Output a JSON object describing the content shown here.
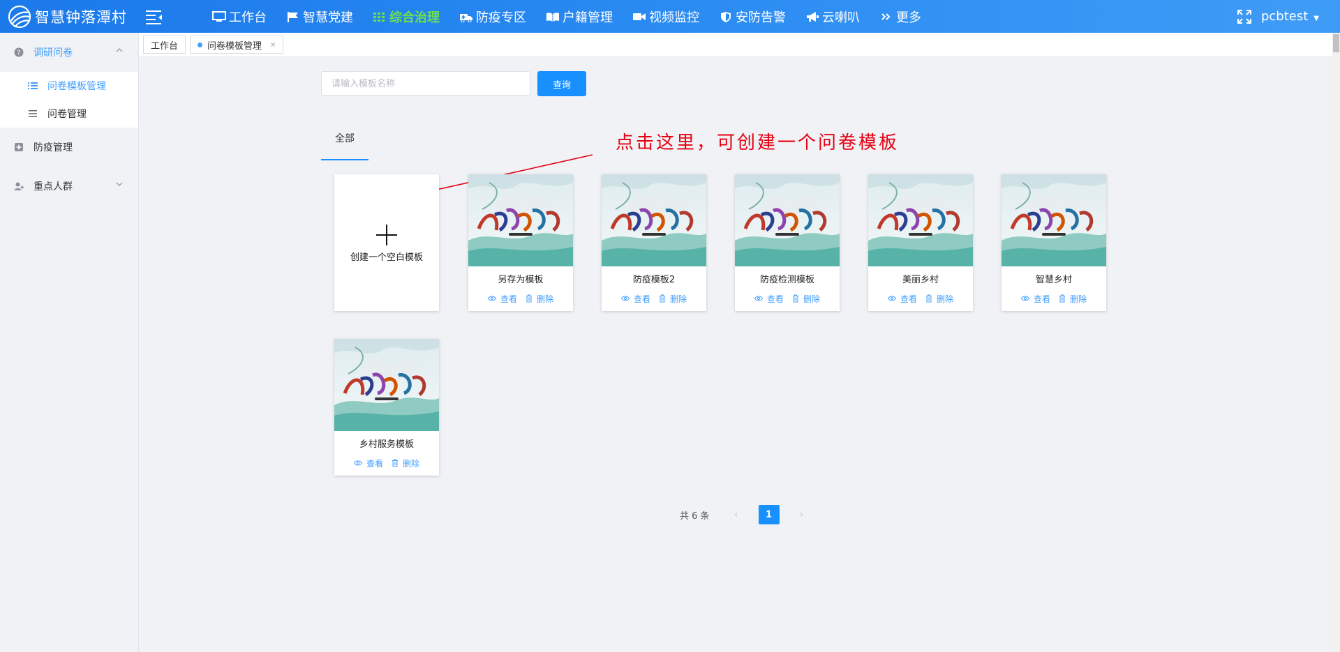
{
  "app": {
    "title": "智慧钟落潭村"
  },
  "nav": {
    "items": [
      {
        "label": "工作台",
        "icon": "monitor-icon"
      },
      {
        "label": "智慧党建",
        "icon": "flag-icon"
      },
      {
        "label": "综合治理",
        "icon": "grid-icon",
        "active": true
      },
      {
        "label": "防疫专区",
        "icon": "ambulance-icon"
      },
      {
        "label": "户籍管理",
        "icon": "book-icon"
      },
      {
        "label": "视频监控",
        "icon": "video-camera-icon"
      },
      {
        "label": "安防告警",
        "icon": "shield-icon"
      },
      {
        "label": "云喇叭",
        "icon": "megaphone-icon"
      },
      {
        "label": "更多",
        "icon": "double-chevron-icon"
      }
    ]
  },
  "user": {
    "name": "pcbtest"
  },
  "sidebar": {
    "groups": [
      {
        "label": "调研问卷",
        "icon": "question-circle-icon",
        "open": true,
        "children": [
          {
            "label": "问卷模板管理",
            "icon": "list-icon",
            "active": true
          },
          {
            "label": "问卷管理",
            "icon": "menu-lines-icon"
          }
        ]
      },
      {
        "label": "防疫管理",
        "icon": "plus-square-icon"
      },
      {
        "label": "重点人群",
        "icon": "user-add-icon"
      }
    ]
  },
  "tabs": [
    {
      "label": "工作台"
    },
    {
      "label": "问卷模板管理",
      "closable": true,
      "close": "×"
    }
  ],
  "search": {
    "placeholder": "请输入模板名称",
    "value": "",
    "button": "查询"
  },
  "category_tab": "全部",
  "annotation": "点击这里，可创建一个问卷模板",
  "blank_template": {
    "label": "创建一个空白模板"
  },
  "templates": [
    {
      "title": "另存为模板"
    },
    {
      "title": "防疫模板2"
    },
    {
      "title": "防疫检测模板"
    },
    {
      "title": "美丽乡村"
    },
    {
      "title": "智慧乡村"
    },
    {
      "title": "乡村服务模板"
    }
  ],
  "actions": {
    "view": "查看",
    "delete": "删除"
  },
  "pagination": {
    "total": "共 6 条",
    "current": "1",
    "prev": "‹",
    "next": "›"
  },
  "colors": {
    "primary": "#1890ff",
    "active_nav": "#6fe04a",
    "annotation": "#e60012",
    "topbar": "#2a8bf2"
  }
}
